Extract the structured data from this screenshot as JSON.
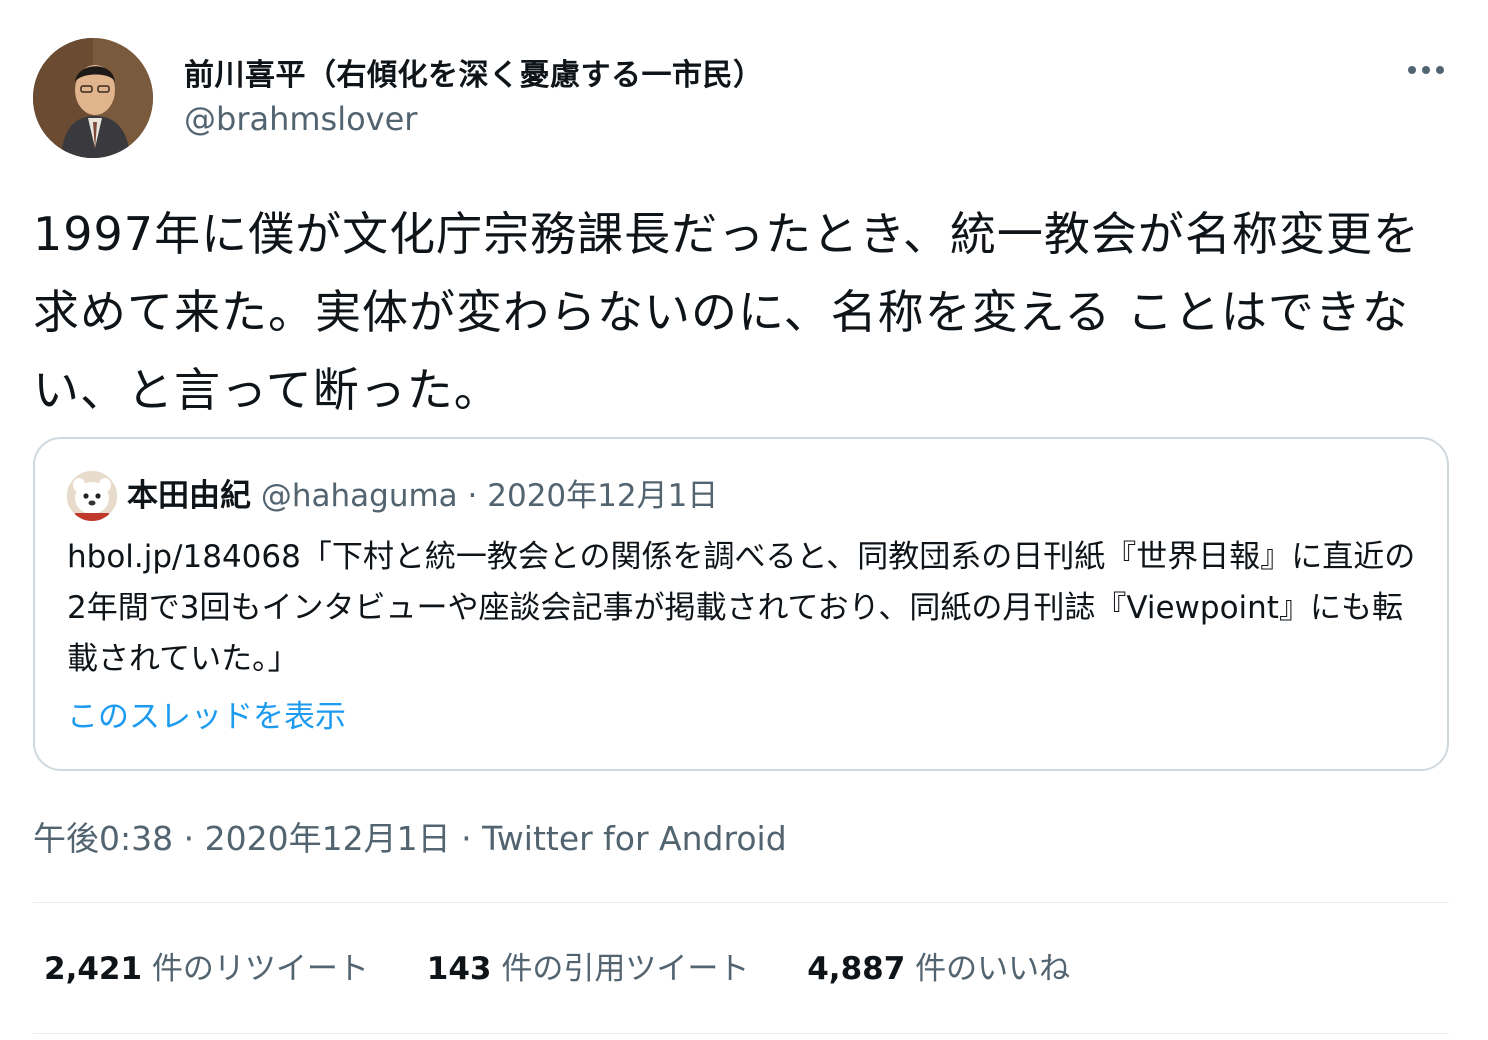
{
  "author": {
    "display_name": "前川喜平（右傾化を深く憂慮する一市民）",
    "handle": "@brahmslover"
  },
  "menu": {
    "icon": "more-icon"
  },
  "tweet": {
    "text": "1997年に僕が文化庁宗務課長だったとき、統一教会が名称変更を求めて来た。実体が変わらないのに、名称を変える ことはできない、と言って断った。"
  },
  "quote": {
    "author_name": "本田由紀",
    "author_handle": "@hahaguma",
    "separator": "·",
    "date": "2020年12月1日",
    "text": "hbol.jp/184068「下村と統一教会との関係を調べると、同教団系の日刊紙『世界日報』に直近の2年間で3回もインタビューや座談会記事が掲載されており、同紙の月刊誌『Viewpoint』にも転載されていた。」",
    "show_thread": "このスレッドを表示"
  },
  "meta": {
    "time": "午後0:38",
    "sep1": "·",
    "date": "2020年12月1日",
    "sep2": "·",
    "source": "Twitter for Android"
  },
  "stats": {
    "retweets": {
      "count": "2,421",
      "label": "件のリツイート"
    },
    "quotes": {
      "count": "143",
      "label": "件の引用ツイート"
    },
    "likes": {
      "count": "4,887",
      "label": "件のいいね"
    }
  },
  "colors": {
    "text": "#0f1419",
    "secondary": "#536471",
    "link": "#1d9bf0",
    "border": "#cfd9de"
  }
}
